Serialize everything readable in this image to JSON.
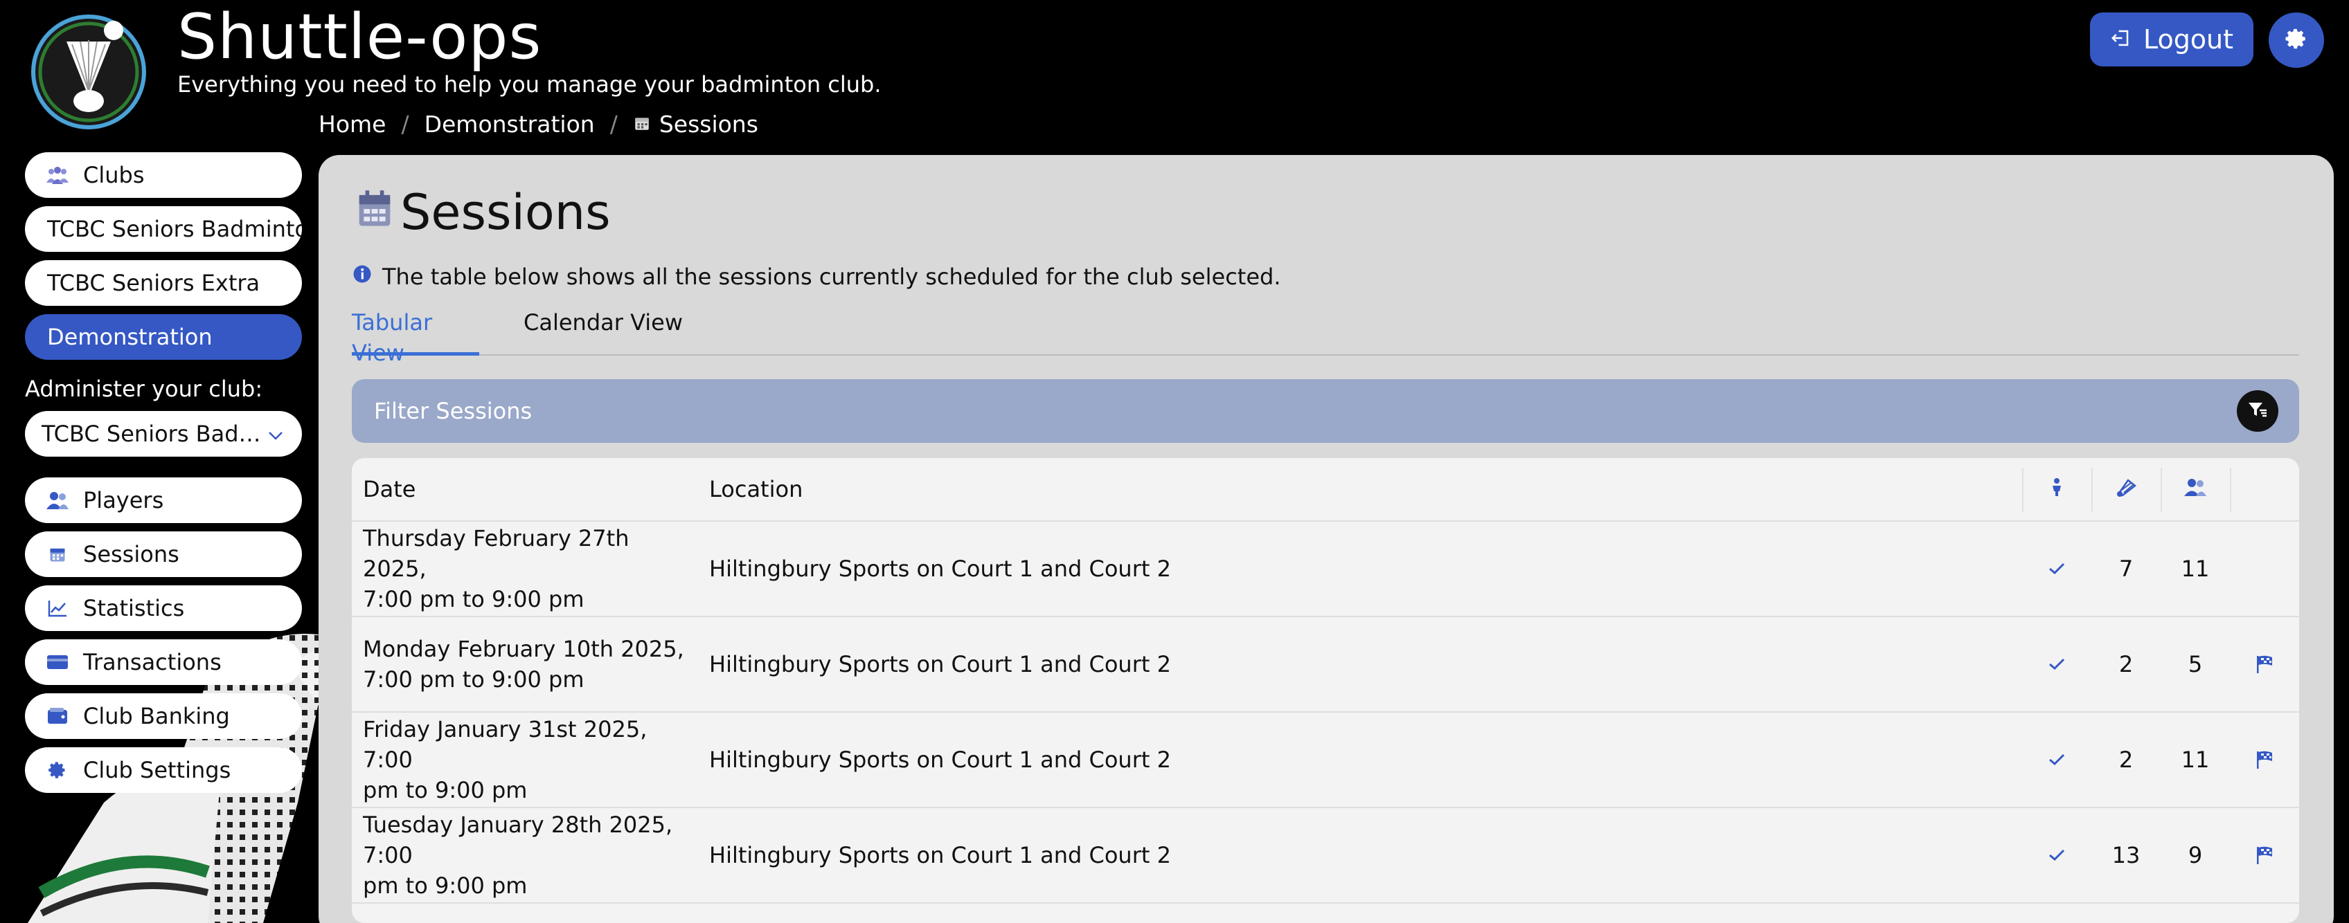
{
  "app": {
    "title": "Shuttle-ops",
    "subtitle": "Everything you need to help you manage your badminton club."
  },
  "header": {
    "logout_label": "Logout",
    "logout_icon": "logout-icon",
    "settings_icon": "gear-icon"
  },
  "breadcrumb": {
    "items": [
      "Home",
      "Demonstration",
      "Sessions"
    ],
    "separator": "/",
    "current_icon": "calendar-icon"
  },
  "sidebar": {
    "clubs_label": "Clubs",
    "clubs": [
      {
        "label": "TCBC Seniors Badminton",
        "active": false
      },
      {
        "label": "TCBC Seniors Extra",
        "active": false
      },
      {
        "label": "Demonstration",
        "active": true
      }
    ],
    "admin_label": "Administer your club:",
    "club_select_value": "TCBC Seniors Badminton",
    "nav": [
      {
        "label": "Players",
        "icon": "users-icon"
      },
      {
        "label": "Sessions",
        "icon": "calendar-icon"
      },
      {
        "label": "Statistics",
        "icon": "chart-line-icon"
      },
      {
        "label": "Transactions",
        "icon": "credit-card-icon"
      },
      {
        "label": "Club Banking",
        "icon": "wallet-icon"
      },
      {
        "label": "Club Settings",
        "icon": "gear-icon"
      }
    ]
  },
  "main": {
    "title": "Sessions",
    "info": "The table below shows all the sessions currently scheduled for the club selected.",
    "tabs": [
      {
        "label": "Tabular View",
        "active": true
      },
      {
        "label": "Calendar View",
        "active": false
      }
    ],
    "filter_label": "Filter Sessions",
    "table": {
      "columns": [
        "Date",
        "Location"
      ],
      "icon_columns": [
        "attendance-icon",
        "shuttlecock-icon",
        "players-icon"
      ],
      "rows": [
        {
          "date_line1": "Thursday February 27th 2025,",
          "date_line2": "7:00 pm to 9:00 pm",
          "location": "Hiltingbury Sports on Court 1 and Court 2",
          "checked": true,
          "shuttles": "7",
          "players": "11",
          "flag": false
        },
        {
          "date_line1": "Monday February 10th 2025,",
          "date_line2": "7:00 pm to 9:00 pm",
          "location": "Hiltingbury Sports on Court 1 and Court 2",
          "checked": true,
          "shuttles": "2",
          "players": "5",
          "flag": true
        },
        {
          "date_line1": "Friday January 31st 2025, 7:00",
          "date_line2": "pm to 9:00 pm",
          "location": "Hiltingbury Sports on Court 1 and Court 2",
          "checked": true,
          "shuttles": "2",
          "players": "11",
          "flag": true
        },
        {
          "date_line1": "Tuesday January 28th 2025, 7:00",
          "date_line2": "pm to 9:00 pm",
          "location": "Hiltingbury Sports on Court 1 and Court 2",
          "checked": true,
          "shuttles": "13",
          "players": "9",
          "flag": true
        }
      ]
    }
  },
  "colors": {
    "accent": "#3558c4",
    "tab_active": "#3b6fd6",
    "filter_bar": "#9aa8c9",
    "panel": "#d9d9d9"
  }
}
